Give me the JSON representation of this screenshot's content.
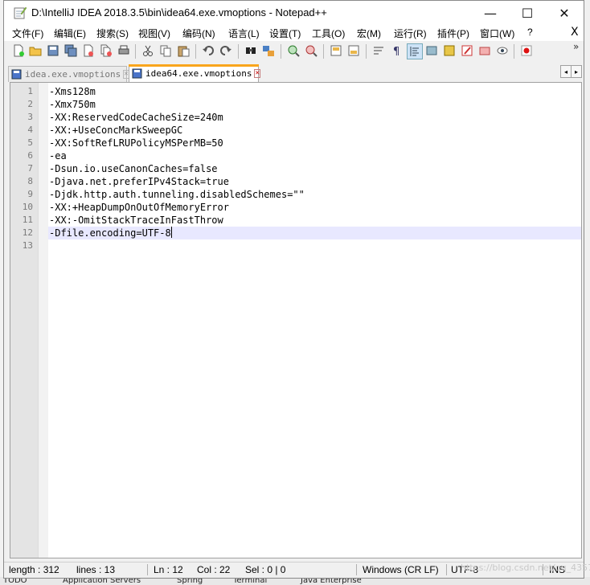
{
  "window": {
    "title": "D:\\IntelliJ IDEA 2018.3.5\\bin\\idea64.exe.vmoptions - Notepad++",
    "minimize": "—",
    "maximize": "☐",
    "close": "✕"
  },
  "menu": [
    "文件(F)",
    "编辑(E)",
    "搜索(S)",
    "视图(V)",
    "编码(N)",
    "语言(L)",
    "设置(T)",
    "工具(O)",
    "宏(M)",
    "运行(R)",
    "插件(P)",
    "窗口(W)",
    "?"
  ],
  "menu_close": "X",
  "toolbar": {
    "icons": [
      "new-file-icon",
      "open-file-icon",
      "save-icon",
      "save-all-icon",
      "close-icon",
      "close-all-icon",
      "print-icon",
      "cut-icon",
      "copy-icon",
      "paste-icon",
      "undo-icon",
      "redo-icon",
      "find-icon",
      "replace-icon",
      "zoom-in-icon",
      "zoom-out-icon",
      "sync-vertical-icon",
      "sync-horizontal-icon",
      "word-wrap-icon",
      "show-all-chars-icon",
      "indent-guide-icon",
      "doc-map-icon",
      "function-list-icon",
      "folder-workspace-icon",
      "monitoring-icon",
      "preview-icon",
      "record-macro-icon"
    ],
    "more": "»"
  },
  "tabs": [
    {
      "label": "idea.exe.vmoptions",
      "active": false
    },
    {
      "label": "idea64.exe.vmoptions",
      "active": true
    }
  ],
  "tab_nav": {
    "left": "◂",
    "right": "▸"
  },
  "editor": {
    "current_line": 12,
    "lines": [
      {
        "n": "1",
        "text": "-Xms128m"
      },
      {
        "n": "2",
        "text": "-Xmx750m"
      },
      {
        "n": "3",
        "text": "-XX:ReservedCodeCacheSize=240m"
      },
      {
        "n": "4",
        "text": "-XX:+UseConcMarkSweepGC"
      },
      {
        "n": "5",
        "text": "-XX:SoftRefLRUPolicyMSPerMB=50"
      },
      {
        "n": "6",
        "text": "-ea"
      },
      {
        "n": "7",
        "text": "-Dsun.io.useCanonCaches=false"
      },
      {
        "n": "8",
        "text": "-Djava.net.preferIPv4Stack=true"
      },
      {
        "n": "9",
        "text": "-Djdk.http.auth.tunneling.disabledSchemes=\"\""
      },
      {
        "n": "10",
        "text": "-XX:+HeapDumpOnOutOfMemoryError"
      },
      {
        "n": "11",
        "text": "-XX:-OmitStackTraceInFastThrow"
      },
      {
        "n": "12",
        "text": "-Dfile.encoding=UTF-8"
      },
      {
        "n": "13",
        "text": ""
      }
    ]
  },
  "status": {
    "length": "length : 312",
    "lines": "lines : 13",
    "ln": "Ln : 12",
    "col": "Col : 22",
    "sel": "Sel : 0 | 0",
    "eol": "Windows (CR LF)",
    "encoding": "UTF-8",
    "mode": "INS",
    "watermark": "https://blog.csdn.net/qq_43573043"
  },
  "background_ide": {
    "bottom_tabs": [
      "TODO",
      "Application Servers",
      "Spring",
      "Terminal",
      "Java Enterprise"
    ]
  },
  "colors": {
    "current_line": "#e8e8ff",
    "active_tab_accent": "#f9a51c",
    "gutter": "#e4e4e4"
  }
}
